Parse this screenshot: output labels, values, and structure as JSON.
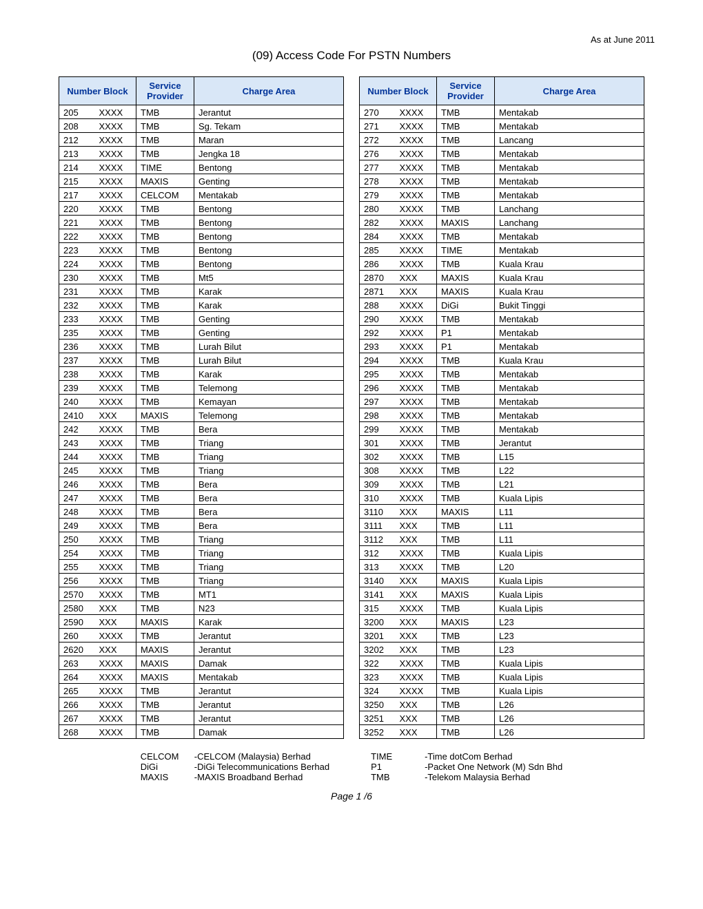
{
  "as_at": "As at June 2011",
  "title": "(09) Access Code For PSTN Numbers",
  "headers": {
    "number_block": "Number Block",
    "service_provider": "Service Provider",
    "charge_area": "Charge Area"
  },
  "left_rows": [
    {
      "n1": "205",
      "n2": "XXXX",
      "sp": "TMB",
      "ca": "Jerantut"
    },
    {
      "n1": "208",
      "n2": "XXXX",
      "sp": "TMB",
      "ca": "Sg. Tekam"
    },
    {
      "n1": "212",
      "n2": "XXXX",
      "sp": "TMB",
      "ca": "Maran"
    },
    {
      "n1": "213",
      "n2": "XXXX",
      "sp": "TMB",
      "ca": "Jengka 18"
    },
    {
      "n1": "214",
      "n2": "XXXX",
      "sp": "TIME",
      "ca": "Bentong"
    },
    {
      "n1": "215",
      "n2": "XXXX",
      "sp": "MAXIS",
      "ca": "Genting"
    },
    {
      "n1": "217",
      "n2": "XXXX",
      "sp": "CELCOM",
      "ca": "Mentakab"
    },
    {
      "n1": "220",
      "n2": "XXXX",
      "sp": "TMB",
      "ca": "Bentong"
    },
    {
      "n1": "221",
      "n2": "XXXX",
      "sp": "TMB",
      "ca": "Bentong"
    },
    {
      "n1": "222",
      "n2": "XXXX",
      "sp": "TMB",
      "ca": "Bentong"
    },
    {
      "n1": "223",
      "n2": "XXXX",
      "sp": "TMB",
      "ca": "Bentong"
    },
    {
      "n1": "224",
      "n2": "XXXX",
      "sp": "TMB",
      "ca": "Bentong"
    },
    {
      "n1": "230",
      "n2": "XXXX",
      "sp": "TMB",
      "ca": "Mt5"
    },
    {
      "n1": "231",
      "n2": "XXXX",
      "sp": "TMB",
      "ca": "Karak"
    },
    {
      "n1": "232",
      "n2": "XXXX",
      "sp": "TMB",
      "ca": "Karak"
    },
    {
      "n1": "233",
      "n2": "XXXX",
      "sp": "TMB",
      "ca": "Genting"
    },
    {
      "n1": "235",
      "n2": "XXXX",
      "sp": "TMB",
      "ca": "Genting"
    },
    {
      "n1": "236",
      "n2": "XXXX",
      "sp": "TMB",
      "ca": "Lurah Bilut"
    },
    {
      "n1": "237",
      "n2": "XXXX",
      "sp": "TMB",
      "ca": "Lurah Bilut"
    },
    {
      "n1": "238",
      "n2": "XXXX",
      "sp": "TMB",
      "ca": "Karak"
    },
    {
      "n1": "239",
      "n2": "XXXX",
      "sp": "TMB",
      "ca": "Telemong"
    },
    {
      "n1": "240",
      "n2": "XXXX",
      "sp": "TMB",
      "ca": "Kemayan"
    },
    {
      "n1": "2410",
      "n2": "XXX",
      "sp": "MAXIS",
      "ca": "Telemong"
    },
    {
      "n1": "242",
      "n2": "XXXX",
      "sp": "TMB",
      "ca": "Bera"
    },
    {
      "n1": "243",
      "n2": "XXXX",
      "sp": "TMB",
      "ca": "Triang"
    },
    {
      "n1": "244",
      "n2": "XXXX",
      "sp": "TMB",
      "ca": "Triang"
    },
    {
      "n1": "245",
      "n2": "XXXX",
      "sp": "TMB",
      "ca": "Triang"
    },
    {
      "n1": "246",
      "n2": "XXXX",
      "sp": "TMB",
      "ca": "Bera"
    },
    {
      "n1": "247",
      "n2": "XXXX",
      "sp": "TMB",
      "ca": "Bera"
    },
    {
      "n1": "248",
      "n2": "XXXX",
      "sp": "TMB",
      "ca": "Bera"
    },
    {
      "n1": "249",
      "n2": "XXXX",
      "sp": "TMB",
      "ca": "Bera"
    },
    {
      "n1": "250",
      "n2": "XXXX",
      "sp": "TMB",
      "ca": "Triang"
    },
    {
      "n1": "254",
      "n2": "XXXX",
      "sp": "TMB",
      "ca": "Triang"
    },
    {
      "n1": "255",
      "n2": "XXXX",
      "sp": "TMB",
      "ca": "Triang"
    },
    {
      "n1": "256",
      "n2": "XXXX",
      "sp": "TMB",
      "ca": "Triang"
    },
    {
      "n1": "2570",
      "n2": "XXXX",
      "sp": "TMB",
      "ca": "MT1"
    },
    {
      "n1": "2580",
      "n2": "XXX",
      "sp": "TMB",
      "ca": "N23"
    },
    {
      "n1": "2590",
      "n2": "XXX",
      "sp": "MAXIS",
      "ca": "Karak"
    },
    {
      "n1": "260",
      "n2": "XXXX",
      "sp": "TMB",
      "ca": "Jerantut"
    },
    {
      "n1": "2620",
      "n2": "XXX",
      "sp": "MAXIS",
      "ca": "Jerantut"
    },
    {
      "n1": "263",
      "n2": "XXXX",
      "sp": "MAXIS",
      "ca": "Damak"
    },
    {
      "n1": "264",
      "n2": "XXXX",
      "sp": "MAXIS",
      "ca": "Mentakab"
    },
    {
      "n1": "265",
      "n2": "XXXX",
      "sp": "TMB",
      "ca": "Jerantut"
    },
    {
      "n1": "266",
      "n2": "XXXX",
      "sp": "TMB",
      "ca": "Jerantut"
    },
    {
      "n1": "267",
      "n2": "XXXX",
      "sp": "TMB",
      "ca": "Jerantut"
    },
    {
      "n1": "268",
      "n2": "XXXX",
      "sp": "TMB",
      "ca": "Damak"
    }
  ],
  "right_rows": [
    {
      "n1": "270",
      "n2": "XXXX",
      "sp": "TMB",
      "ca": "Mentakab"
    },
    {
      "n1": "271",
      "n2": "XXXX",
      "sp": "TMB",
      "ca": "Mentakab"
    },
    {
      "n1": "272",
      "n2": "XXXX",
      "sp": "TMB",
      "ca": "Lancang"
    },
    {
      "n1": "276",
      "n2": "XXXX",
      "sp": "TMB",
      "ca": "Mentakab"
    },
    {
      "n1": "277",
      "n2": "XXXX",
      "sp": "TMB",
      "ca": "Mentakab"
    },
    {
      "n1": "278",
      "n2": "XXXX",
      "sp": "TMB",
      "ca": "Mentakab"
    },
    {
      "n1": "279",
      "n2": "XXXX",
      "sp": "TMB",
      "ca": "Mentakab"
    },
    {
      "n1": "280",
      "n2": "XXXX",
      "sp": "TMB",
      "ca": "Lanchang"
    },
    {
      "n1": "282",
      "n2": "XXXX",
      "sp": "MAXIS",
      "ca": "Lanchang"
    },
    {
      "n1": "284",
      "n2": "XXXX",
      "sp": "TMB",
      "ca": "Mentakab"
    },
    {
      "n1": "285",
      "n2": "XXXX",
      "sp": "TIME",
      "ca": "Mentakab"
    },
    {
      "n1": "286",
      "n2": "XXXX",
      "sp": "TMB",
      "ca": "Kuala Krau"
    },
    {
      "n1": "2870",
      "n2": "XXX",
      "sp": "MAXIS",
      "ca": "Kuala Krau"
    },
    {
      "n1": "2871",
      "n2": "XXX",
      "sp": "MAXIS",
      "ca": "Kuala Krau"
    },
    {
      "n1": "288",
      "n2": "XXXX",
      "sp": "DiGi",
      "ca": "Bukit Tinggi"
    },
    {
      "n1": "290",
      "n2": "XXXX",
      "sp": "TMB",
      "ca": "Mentakab"
    },
    {
      "n1": "292",
      "n2": "XXXX",
      "sp": "P1",
      "ca": "Mentakab"
    },
    {
      "n1": "293",
      "n2": "XXXX",
      "sp": "P1",
      "ca": "Mentakab"
    },
    {
      "n1": "294",
      "n2": "XXXX",
      "sp": "TMB",
      "ca": "Kuala Krau"
    },
    {
      "n1": "295",
      "n2": "XXXX",
      "sp": "TMB",
      "ca": "Mentakab"
    },
    {
      "n1": "296",
      "n2": "XXXX",
      "sp": "TMB",
      "ca": "Mentakab"
    },
    {
      "n1": "297",
      "n2": "XXXX",
      "sp": "TMB",
      "ca": "Mentakab"
    },
    {
      "n1": "298",
      "n2": "XXXX",
      "sp": "TMB",
      "ca": "Mentakab"
    },
    {
      "n1": "299",
      "n2": "XXXX",
      "sp": "TMB",
      "ca": "Mentakab"
    },
    {
      "n1": "301",
      "n2": "XXXX",
      "sp": "TMB",
      "ca": "Jerantut"
    },
    {
      "n1": "302",
      "n2": "XXXX",
      "sp": "TMB",
      "ca": "L15"
    },
    {
      "n1": "308",
      "n2": "XXXX",
      "sp": "TMB",
      "ca": "L22"
    },
    {
      "n1": "309",
      "n2": "XXXX",
      "sp": "TMB",
      "ca": "L21"
    },
    {
      "n1": "310",
      "n2": "XXXX",
      "sp": "TMB",
      "ca": "Kuala Lipis"
    },
    {
      "n1": "3110",
      "n2": "XXX",
      "sp": "MAXIS",
      "ca": "L11"
    },
    {
      "n1": "3111",
      "n2": "XXX",
      "sp": "TMB",
      "ca": "L11"
    },
    {
      "n1": "3112",
      "n2": "XXX",
      "sp": "TMB",
      "ca": "L11"
    },
    {
      "n1": "312",
      "n2": "XXXX",
      "sp": "TMB",
      "ca": "Kuala Lipis"
    },
    {
      "n1": "313",
      "n2": "XXXX",
      "sp": "TMB",
      "ca": "L20"
    },
    {
      "n1": "3140",
      "n2": "XXX",
      "sp": "MAXIS",
      "ca": "Kuala Lipis"
    },
    {
      "n1": "3141",
      "n2": "XXX",
      "sp": "MAXIS",
      "ca": "Kuala Lipis"
    },
    {
      "n1": "315",
      "n2": "XXXX",
      "sp": "TMB",
      "ca": "Kuala Lipis"
    },
    {
      "n1": "3200",
      "n2": "XXX",
      "sp": "MAXIS",
      "ca": "L23"
    },
    {
      "n1": "3201",
      "n2": "XXX",
      "sp": "TMB",
      "ca": "L23"
    },
    {
      "n1": "3202",
      "n2": "XXX",
      "sp": "TMB",
      "ca": "L23"
    },
    {
      "n1": "322",
      "n2": "XXXX",
      "sp": "TMB",
      "ca": "Kuala Lipis"
    },
    {
      "n1": "323",
      "n2": "XXXX",
      "sp": "TMB",
      "ca": "Kuala Lipis"
    },
    {
      "n1": "324",
      "n2": "XXXX",
      "sp": "TMB",
      "ca": "Kuala Lipis"
    },
    {
      "n1": "3250",
      "n2": "XXX",
      "sp": "TMB",
      "ca": "L26"
    },
    {
      "n1": "3251",
      "n2": "XXX",
      "sp": "TMB",
      "ca": "L26"
    },
    {
      "n1": "3252",
      "n2": "XXX",
      "sp": "TMB",
      "ca": "L26"
    }
  ],
  "legend_left": [
    {
      "key": "CELCOM",
      "val": "-CELCOM (Malaysia) Berhad"
    },
    {
      "key": "DiGi",
      "val": "-DiGi Telecommunications Berhad"
    },
    {
      "key": "MAXIS",
      "val": "-MAXIS Broadband Berhad"
    }
  ],
  "legend_right": [
    {
      "key": "TIME",
      "val": "-Time dotCom Berhad"
    },
    {
      "key": "P1",
      "val": "-Packet One Network (M) Sdn Bhd"
    },
    {
      "key": "TMB",
      "val": "-Telekom Malaysia Berhad"
    }
  ],
  "pager": "Page 1 /6"
}
